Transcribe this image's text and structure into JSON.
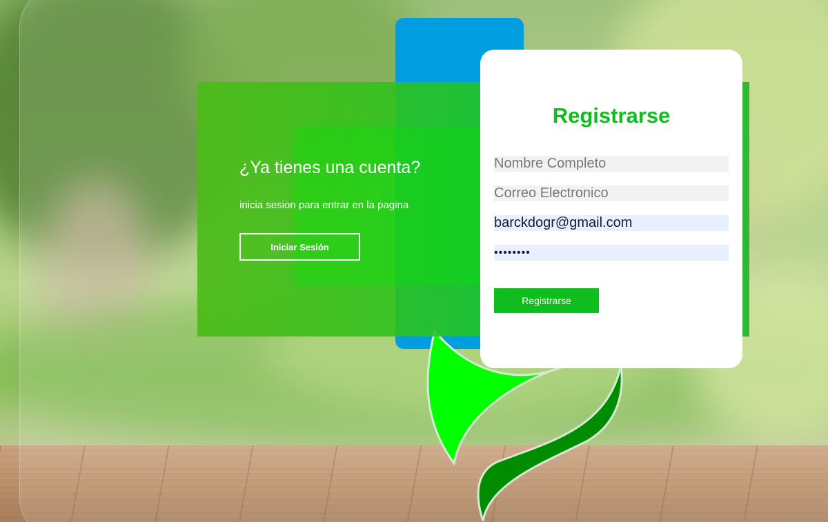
{
  "login_panel": {
    "title": "¿Ya tienes una cuenta?",
    "subtitle": "inicia sesion para entrar en la pagina",
    "login_button": "Iniciar Sesión"
  },
  "register_card": {
    "title": "Registrarse",
    "name_placeholder": "Nombre Completo",
    "email_placeholder": "Correo Electronico",
    "username_value": "barckdogr@gmail.com",
    "password_value": "12345678",
    "register_button": "Registrarse"
  },
  "colors": {
    "accent_green": "#0fbd1c",
    "logo_blue": "#009ee0",
    "panel_green": "#4cbb17"
  }
}
